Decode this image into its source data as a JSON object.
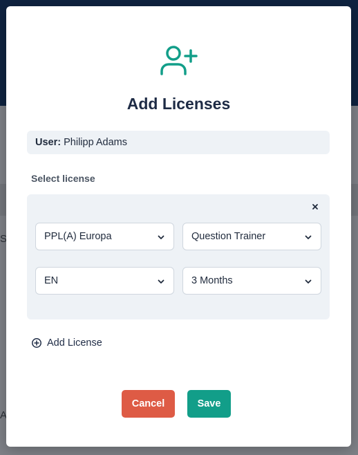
{
  "modal": {
    "title": "Add Licenses",
    "icon": "user-plus-icon",
    "user_label": "User:",
    "user_name": "Philipp Adams",
    "select_label": "Select license",
    "license_rows": [
      {
        "license": "PPL(A) Europa",
        "product": "Question Trainer",
        "language": "EN",
        "duration": "3 Months"
      }
    ],
    "add_license_label": "Add License",
    "cancel_label": "Cancel",
    "save_label": "Save"
  },
  "background": {
    "fragment_s": "S",
    "fragment_a": "A"
  },
  "colors": {
    "accent": "#129e89",
    "danger": "#de5b45",
    "title": "#1e2b45",
    "panel": "#eef2f6",
    "header_dark": "#0f2340"
  }
}
